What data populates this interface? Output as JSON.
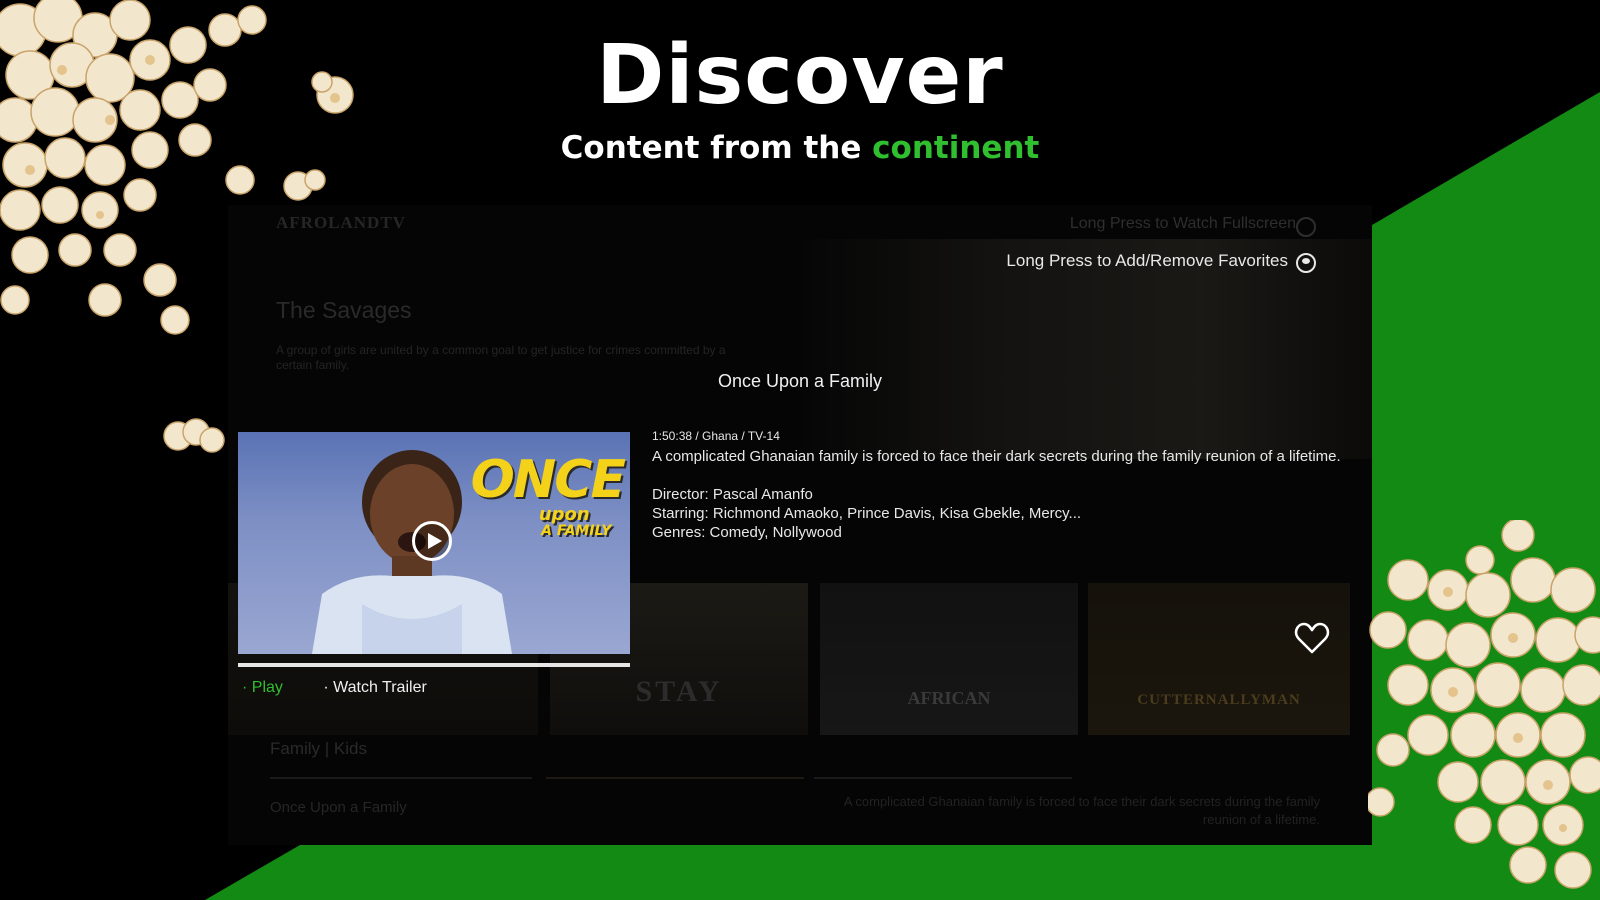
{
  "hero": {
    "title": "Discover",
    "subtitle_prefix": "Content from the",
    "subtitle_accent": "continent"
  },
  "app": {
    "logo_text": "AFROLANDTV",
    "hints": {
      "fullscreen": "Long Press to Watch Fullscreen",
      "favorites": "Long Press to Add/Remove Favorites"
    },
    "background_feature": {
      "title": "The Savages",
      "description": "A group of girls are united by a common goal to get justice for crimes committed by a certain family."
    },
    "focused": {
      "title": "Once Upon a Family",
      "thumbnail_logo": {
        "main": "ONCE",
        "sub": "upon",
        "sub2": "A FAMILY"
      },
      "meta": "1:50:38 / Ghana / TV-14",
      "description": "A complicated Ghanaian family is forced to face their dark secrets during the family reunion of a lifetime.",
      "director": "Director: Pascal Amanfo",
      "starring": "Starring: Richmond Amaoko, Prince Davis, Kisa Gbekle, Mercy...",
      "genres": "Genres: Comedy, Nollywood",
      "progress_fraction": 1.0,
      "actions": {
        "play": "Play",
        "trailer": "Watch Trailer"
      }
    },
    "row_posters": [
      {
        "name": "poster-1",
        "text": ""
      },
      {
        "name": "poster-2",
        "text": "STAY"
      },
      {
        "name": "poster-3",
        "text": "AFRICAN"
      },
      {
        "name": "poster-4",
        "text": "CUTTERNALLYMAN"
      }
    ],
    "section_label": "Family | Kids",
    "bottom_item": {
      "title": "Once Upon a Family",
      "description": "A complicated Ghanaian family is forced to face their dark secrets during the family reunion of a lifetime."
    }
  },
  "colors": {
    "accent_green": "#2fbf2f",
    "backdrop_green": "#138a13",
    "background": "#000000"
  },
  "icons": [
    "play-icon",
    "heart-icon",
    "hint-icon",
    "popcorn-icon"
  ]
}
